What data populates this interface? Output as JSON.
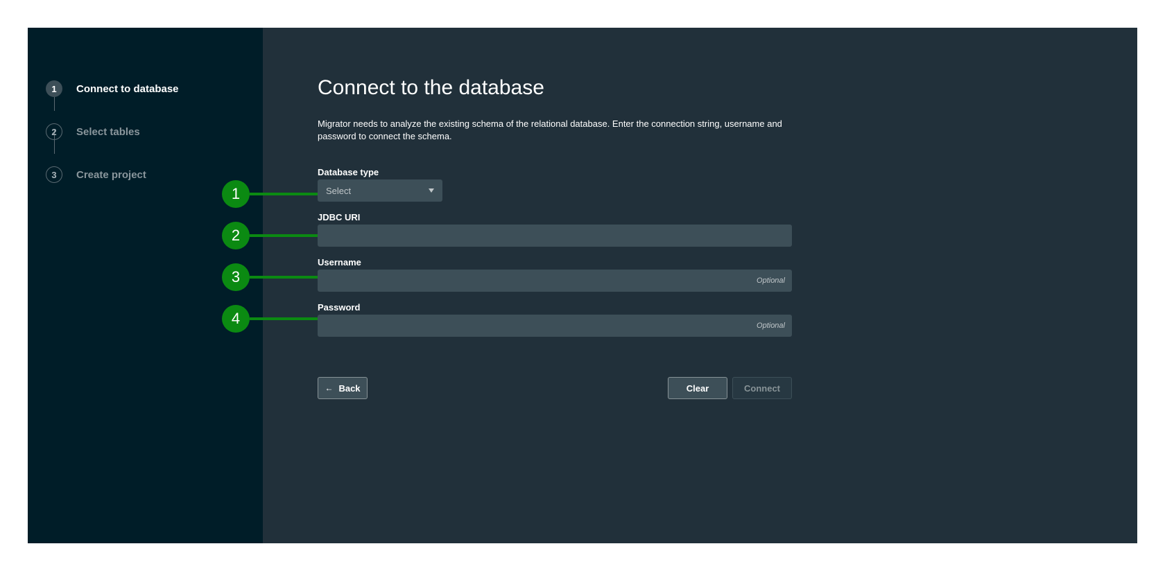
{
  "stepper": {
    "steps": [
      {
        "number": "1",
        "label": "Connect to database",
        "active": true
      },
      {
        "number": "2",
        "label": "Select tables",
        "active": false
      },
      {
        "number": "3",
        "label": "Create project",
        "active": false
      }
    ]
  },
  "main": {
    "title": "Connect to the database",
    "description": "Migrator needs to analyze the existing schema of the relational database. Enter the connection string, username and password to connect the schema.",
    "fields": {
      "database_type": {
        "label": "Database type",
        "value": "Select"
      },
      "jdbc_uri": {
        "label": "JDBC URI",
        "value": ""
      },
      "username": {
        "label": "Username",
        "value": "",
        "hint": "Optional"
      },
      "password": {
        "label": "Password",
        "value": "",
        "hint": "Optional"
      }
    },
    "buttons": {
      "back": "Back",
      "clear": "Clear",
      "connect": "Connect"
    }
  },
  "callouts": [
    "1",
    "2",
    "3",
    "4"
  ],
  "colors": {
    "sidebar_bg": "#001d28",
    "main_bg": "#21303a",
    "input_bg": "#3d4f58",
    "callout": "#0b8a12"
  },
  "icons": {
    "select_caret": "chevron-down-icon",
    "back_arrow": "arrow-left-icon"
  }
}
